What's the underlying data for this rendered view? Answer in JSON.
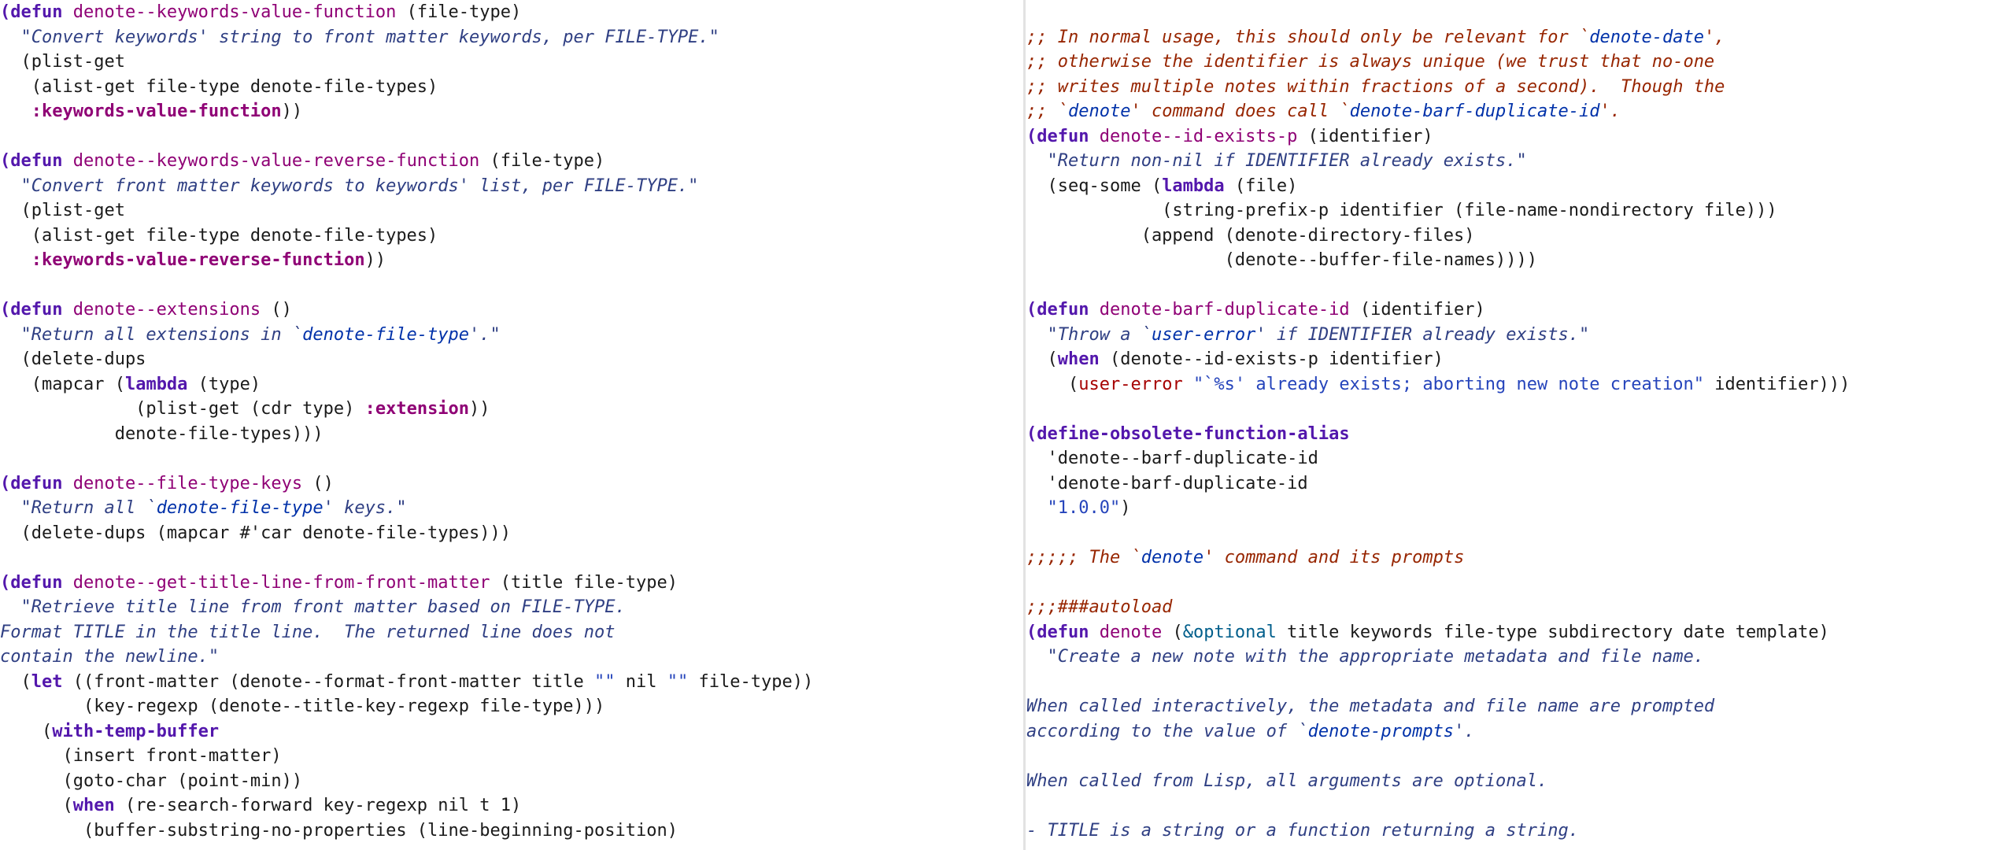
{
  "editor": {
    "left_pane": {
      "lines": [
        [
          [
            "kw",
            "(defun "
          ],
          [
            "fn",
            "denote--keywords-value-function"
          ],
          [
            "text",
            " (file-type)"
          ]
        ],
        [
          [
            "doc",
            "  \"Convert keywords' string to front matter keywords, per FILE-TYPE.\""
          ]
        ],
        [
          [
            "text",
            "  (plist-get"
          ]
        ],
        [
          [
            "text",
            "   (alist-get file-type denote-file-types)"
          ]
        ],
        [
          [
            "sym",
            "   :keywords-value-function"
          ],
          [
            "text",
            "))"
          ]
        ],
        [],
        [
          [
            "kw",
            "(defun "
          ],
          [
            "fn",
            "denote--keywords-value-reverse-function"
          ],
          [
            "text",
            " (file-type)"
          ]
        ],
        [
          [
            "doc",
            "  \"Convert front matter keywords to keywords' list, per FILE-TYPE.\""
          ]
        ],
        [
          [
            "text",
            "  (plist-get"
          ]
        ],
        [
          [
            "text",
            "   (alist-get file-type denote-file-types)"
          ]
        ],
        [
          [
            "sym",
            "   :keywords-value-reverse-function"
          ],
          [
            "text",
            "))"
          ]
        ],
        [],
        [
          [
            "kw",
            "(defun "
          ],
          [
            "fn",
            "denote--extensions"
          ],
          [
            "text",
            " ()"
          ]
        ],
        [
          [
            "doc",
            "  \"Return all extensions in `"
          ],
          [
            "ref",
            "denote-file-type"
          ],
          [
            "doc",
            "'.\""
          ]
        ],
        [
          [
            "text",
            "  (delete-dups"
          ]
        ],
        [
          [
            "text",
            "   (mapcar ("
          ],
          [
            "kw",
            "lambda"
          ],
          [
            "text",
            " (type)"
          ]
        ],
        [
          [
            "text",
            "             (plist-get (cdr type) "
          ],
          [
            "sym",
            ":extension"
          ],
          [
            "text",
            "))"
          ]
        ],
        [
          [
            "text",
            "           denote-file-types)))"
          ]
        ],
        [],
        [
          [
            "kw",
            "(defun "
          ],
          [
            "fn",
            "denote--file-type-keys"
          ],
          [
            "text",
            " ()"
          ]
        ],
        [
          [
            "doc",
            "  \"Return all `"
          ],
          [
            "ref",
            "denote-file-type"
          ],
          [
            "doc",
            "' keys.\""
          ]
        ],
        [
          [
            "text",
            "  (delete-dups (mapcar #'car denote-file-types)))"
          ]
        ],
        [],
        [
          [
            "kw",
            "(defun "
          ],
          [
            "fn",
            "denote--get-title-line-from-front-matter"
          ],
          [
            "text",
            " (title file-type)"
          ]
        ],
        [
          [
            "doc",
            "  \"Retrieve title line from front matter based on FILE-TYPE."
          ]
        ],
        [
          [
            "doc",
            "Format TITLE in the title line.  The returned line does not"
          ]
        ],
        [
          [
            "doc",
            "contain the newline.\""
          ]
        ],
        [
          [
            "text",
            "  ("
          ],
          [
            "kw",
            "let"
          ],
          [
            "text",
            " ((front-matter (denote--format-front-matter title "
          ],
          [
            "str",
            "\"\""
          ],
          [
            "text",
            " nil "
          ],
          [
            "str",
            "\"\""
          ],
          [
            "text",
            " file-type))"
          ]
        ],
        [
          [
            "text",
            "        (key-regexp (denote--title-key-regexp file-type)))"
          ]
        ],
        [
          [
            "text",
            "    ("
          ],
          [
            "kw",
            "with-temp-buffer"
          ]
        ],
        [
          [
            "text",
            "      (insert front-matter)"
          ]
        ],
        [
          [
            "text",
            "      (goto-char (point-min))"
          ]
        ],
        [
          [
            "text",
            "      ("
          ],
          [
            "kw",
            "when"
          ],
          [
            "text",
            " (re-search-forward key-regexp nil t 1)"
          ]
        ],
        [
          [
            "text",
            "        (buffer-substring-no-properties (line-beginning-position)"
          ]
        ]
      ]
    },
    "right_pane": {
      "lines": [
        [],
        [
          [
            "com",
            ";; In normal usage, this should only be relevant for `"
          ],
          [
            "ref",
            "denote-date"
          ],
          [
            "com",
            "',"
          ]
        ],
        [
          [
            "com",
            ";; otherwise the identifier is always unique (we trust that no-one"
          ]
        ],
        [
          [
            "com",
            ";; writes multiple notes within fractions of a second).  Though the"
          ]
        ],
        [
          [
            "com",
            ";; `"
          ],
          [
            "ref",
            "denote"
          ],
          [
            "com",
            "' command does call `"
          ],
          [
            "ref",
            "denote-barf-duplicate-id"
          ],
          [
            "com",
            "'."
          ]
        ],
        [
          [
            "kw",
            "(defun "
          ],
          [
            "fn",
            "denote--id-exists-p"
          ],
          [
            "text",
            " (identifier)"
          ]
        ],
        [
          [
            "doc",
            "  \"Return non-nil if IDENTIFIER already exists.\""
          ]
        ],
        [
          [
            "text",
            "  (seq-some ("
          ],
          [
            "kw",
            "lambda"
          ],
          [
            "text",
            " (file)"
          ]
        ],
        [
          [
            "text",
            "             (string-prefix-p identifier (file-name-nondirectory file)))"
          ]
        ],
        [
          [
            "text",
            "           (append (denote-directory-files)"
          ]
        ],
        [
          [
            "text",
            "                   (denote--buffer-file-names))))"
          ]
        ],
        [],
        [
          [
            "kw",
            "(defun "
          ],
          [
            "fn",
            "denote-barf-duplicate-id"
          ],
          [
            "text",
            " (identifier)"
          ]
        ],
        [
          [
            "doc",
            "  \"Throw a `"
          ],
          [
            "ref",
            "user-error"
          ],
          [
            "doc",
            "' if IDENTIFIER already exists.\""
          ]
        ],
        [
          [
            "text",
            "  ("
          ],
          [
            "kw",
            "when"
          ],
          [
            "text",
            " (denote--id-exists-p identifier)"
          ]
        ],
        [
          [
            "text",
            "    ("
          ],
          [
            "err",
            "user-error"
          ],
          [
            "text",
            " "
          ],
          [
            "str",
            "\"`%s' already exists; aborting new note creation\""
          ],
          [
            "text",
            " identifier)))"
          ]
        ],
        [],
        [
          [
            "kw",
            "(define-obsolete-function-alias"
          ]
        ],
        [
          [
            "text",
            "  'denote--barf-duplicate-id"
          ]
        ],
        [
          [
            "text",
            "  'denote-barf-duplicate-id"
          ]
        ],
        [
          [
            "str",
            "  \"1.0.0\""
          ],
          [
            "text",
            ")"
          ]
        ],
        [],
        [
          [
            "com",
            ";;;;; The `"
          ],
          [
            "ref",
            "denote"
          ],
          [
            "com",
            "' command and its prompts"
          ]
        ],
        [],
        [
          [
            "com",
            ";;;###autoload"
          ]
        ],
        [
          [
            "kw",
            "(defun "
          ],
          [
            "fn",
            "denote"
          ],
          [
            "text",
            " ("
          ],
          [
            "opt",
            "&optional"
          ],
          [
            "text",
            " title keywords file-type subdirectory date template)"
          ]
        ],
        [
          [
            "doc",
            "  \"Create a new note with the appropriate metadata and file name."
          ]
        ],
        [],
        [
          [
            "doc",
            "When called interactively, the metadata and file name are prompted"
          ]
        ],
        [
          [
            "doc",
            "according to the value of `"
          ],
          [
            "ref",
            "denote-prompts"
          ],
          [
            "doc",
            "'."
          ]
        ],
        [],
        [
          [
            "doc",
            "When called from Lisp, all arguments are optional."
          ]
        ],
        [],
        [
          [
            "doc",
            "- TITLE is a string or a function returning a string."
          ]
        ]
      ]
    }
  },
  "colors": {
    "background": "#ffffff",
    "keyword": "#5317ac",
    "function_name": "#8f0075",
    "docstring": "#2f3f83",
    "reference": "#0031a9",
    "string": "#2544bb",
    "comment": "#972500",
    "error": "#a60000",
    "optional": "#005e8b",
    "divider": "#e2e2e2"
  }
}
